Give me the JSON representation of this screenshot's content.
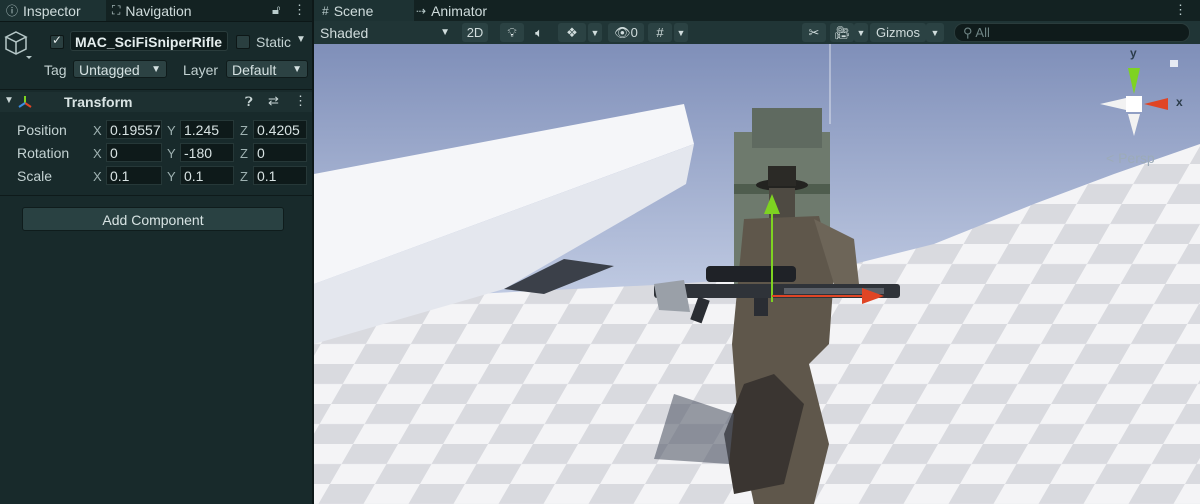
{
  "inspector_tabs": [
    {
      "label": "Inspector",
      "icon": "info-icon"
    },
    {
      "label": "Navigation",
      "icon": "navigation-icon"
    }
  ],
  "scene_tabs": [
    {
      "label": "Scene",
      "icon": "grid-icon"
    },
    {
      "label": "Animator",
      "icon": "animator-icon"
    }
  ],
  "object": {
    "active": true,
    "name": "MAC_SciFiSniperRifle",
    "static_label": "Static",
    "static": false,
    "tag_label": "Tag",
    "tag_value": "Untagged",
    "layer_label": "Layer",
    "layer_value": "Default"
  },
  "transform": {
    "title": "Transform",
    "rows": [
      {
        "label": "Position",
        "x": "0.19557",
        "y": "1.245",
        "z": "0.4205"
      },
      {
        "label": "Rotation",
        "x": "0",
        "y": "-180",
        "z": "0"
      },
      {
        "label": "Scale",
        "x": "0.1",
        "y": "0.1",
        "z": "0.1"
      }
    ],
    "axis_x": "X",
    "axis_y": "Y",
    "axis_z": "Z"
  },
  "add_component_label": "Add Component",
  "scene_toolbar": {
    "shading": "Shaded",
    "mode_2d": "2D",
    "hidden_count": "0",
    "gizmos": "Gizmos",
    "search_placeholder": "All"
  },
  "gizmo": {
    "y_label": "y",
    "x_label": "x",
    "projection": "Persp"
  },
  "colors": {
    "panel_bg": "#182a2b",
    "sky_top": "#7f8fb9",
    "sky_bottom": "#c6d0e6",
    "gizmo_y": "#7ed321",
    "gizmo_x": "#e04525"
  }
}
